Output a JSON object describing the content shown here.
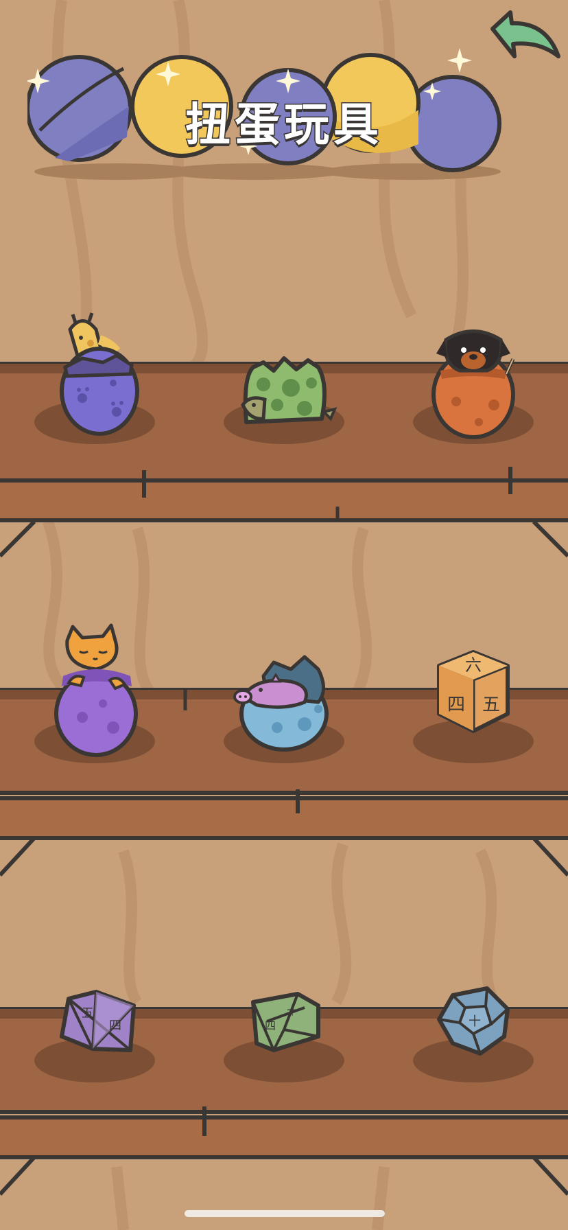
{
  "header": {
    "title": "扭蛋玩具",
    "back_icon": "back-arrow-icon"
  },
  "colors": {
    "wall": "#c8a07a",
    "shelf_wood": "#9e6644",
    "shelf_dark": "#5b3a28",
    "outline": "#3a3634",
    "capsule_blue": "#7f7fc2",
    "capsule_yellow": "#f2c85b",
    "back_arrow": "#7ac28d"
  },
  "shelves": [
    {
      "items": [
        {
          "name": "purple-egg-giraffe",
          "icon": "giraffe-egg-icon"
        },
        {
          "name": "green-egg-turtle",
          "icon": "turtle-egg-icon"
        },
        {
          "name": "orange-egg-dog",
          "icon": "dog-egg-icon"
        }
      ]
    },
    {
      "items": [
        {
          "name": "purple-egg-cat",
          "icon": "cat-egg-icon"
        },
        {
          "name": "blue-egg-pig",
          "icon": "pig-egg-icon"
        },
        {
          "name": "orange-die-cube",
          "icon": "cube-die-icon",
          "faces": [
            "六",
            "四",
            "五"
          ]
        }
      ]
    },
    {
      "items": [
        {
          "name": "purple-die-octahedron",
          "icon": "octahedron-die-icon",
          "faces": [
            "五",
            "四"
          ]
        },
        {
          "name": "green-die-decahedron",
          "icon": "decahedron-die-icon",
          "faces": [
            "十",
            "四"
          ]
        },
        {
          "name": "blue-die-dodecahedron",
          "icon": "dodecahedron-die-icon",
          "faces": [
            "十"
          ]
        }
      ]
    }
  ]
}
